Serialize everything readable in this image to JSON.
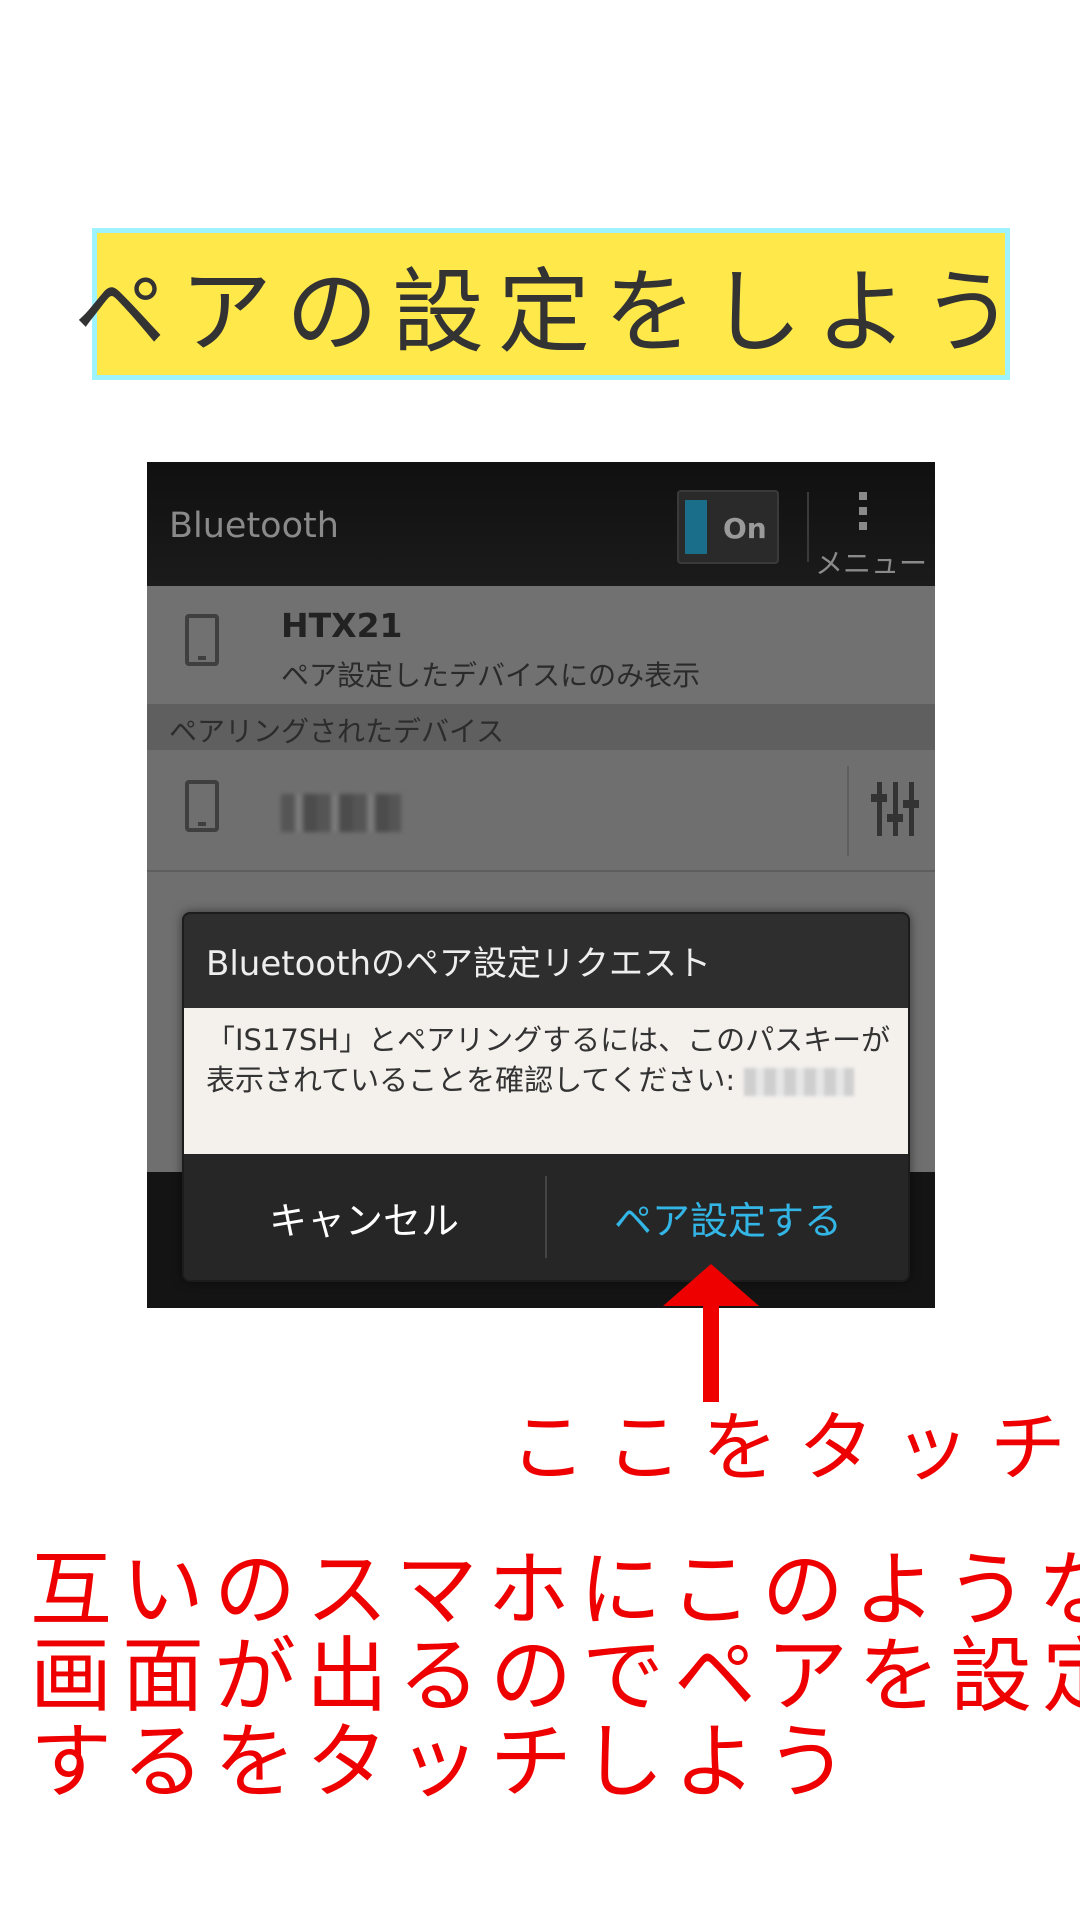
{
  "title": "ペアの設定をしよう",
  "screen": {
    "header": {
      "title": "Bluetooth",
      "toggle_label": "On",
      "menu_label": "メニュー"
    },
    "this_device": {
      "name": "HTX21",
      "subtitle": "ペア設定したデバイスにのみ表示"
    },
    "paired_section_label": "ペアリングされたデバイス",
    "paired_devices": [
      {
        "name": "(blurred)"
      }
    ],
    "dialog": {
      "title": "Bluetoothのペア設定リクエスト",
      "message": "「IS17SH」とペアリングするには、このパスキーが表示されていることを確認してください:",
      "cancel_label": "キャンセル",
      "pair_label": "ペア設定する"
    }
  },
  "annotation": {
    "touch_label": "ここをタッチ",
    "instruction_lines": [
      "互いのスマホにこのような",
      "画面が出るのでペアを設定",
      "するをタッチしよう"
    ],
    "accent_color": "#ee0000"
  },
  "colors": {
    "banner_fill": "#ffe84a",
    "banner_border": "#9ff3ff",
    "pair_button": "#33b5e5"
  }
}
